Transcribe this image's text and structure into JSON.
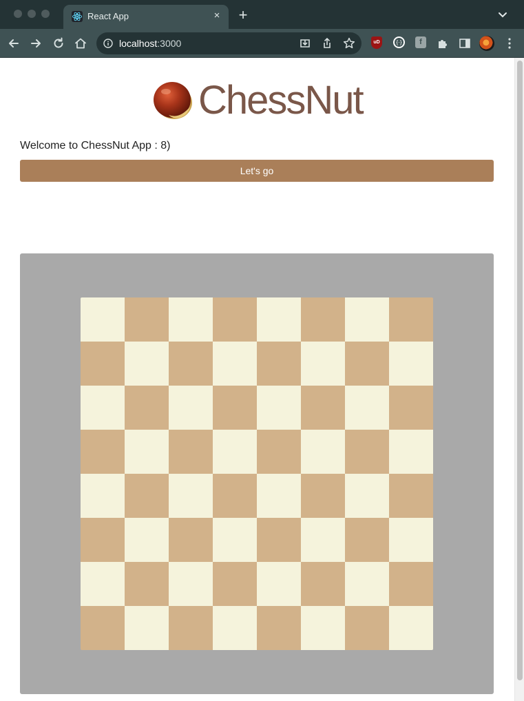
{
  "browser": {
    "tab": {
      "title": "React App",
      "favicon": "react-icon",
      "close": "×"
    },
    "new_tab": "+",
    "url_host": "localhost",
    "url_port": ":3000"
  },
  "page": {
    "logo_text": "ChessNut",
    "welcome": "Welcome to ChessNut App : 8)",
    "button_label": "Let's go"
  },
  "board": {
    "size": 8,
    "first_square": "light",
    "colors": {
      "light": "#f5f3dc",
      "dark": "#d2b28a",
      "frame": "#a9a9a9",
      "button": "#aa7f59"
    }
  }
}
